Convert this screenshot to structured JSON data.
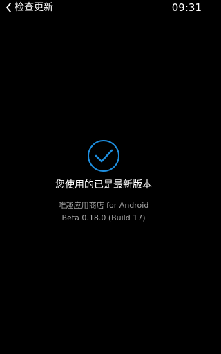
{
  "header": {
    "back_icon": "chevron-left-icon",
    "title": "检查更新",
    "time": "09:31"
  },
  "main": {
    "status_icon": "check-circle-icon",
    "status_icon_color": "#1e8fe0",
    "message": "您使用的已是最新版本",
    "app_name": "唯趣应用商店 for Android",
    "version": "Beta 0.18.0 (Build 17)"
  },
  "colors": {
    "background": "#000000",
    "primary_text": "#ffffff",
    "secondary_text": "#a7a7a7",
    "accent": "#1e8fe0"
  }
}
